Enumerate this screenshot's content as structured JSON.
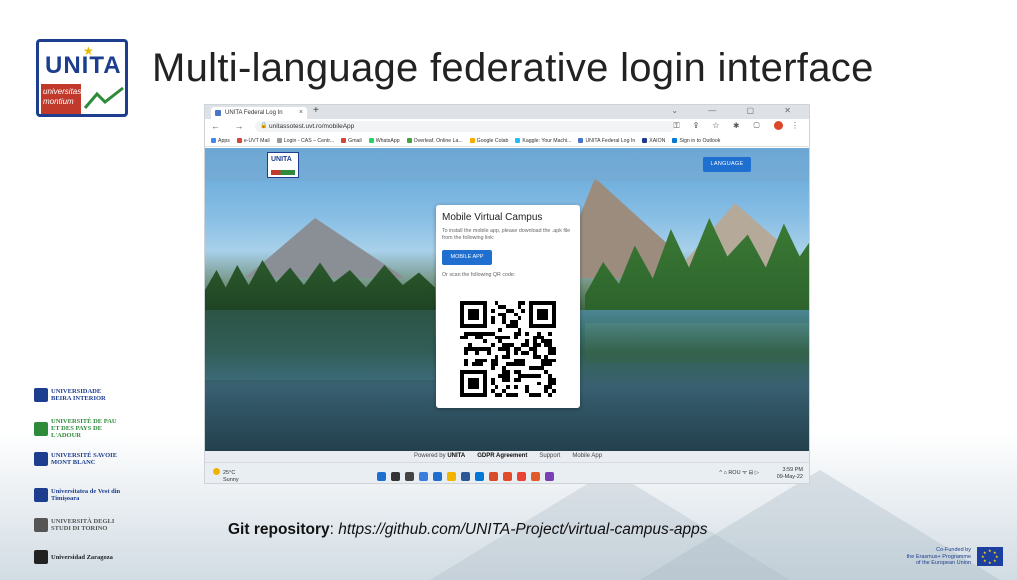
{
  "slide": {
    "title": "Multi-language federative login interface",
    "logo_text": "UNITA",
    "logo_subtitle": "universitas montium",
    "git_label": "Git repository",
    "git_sep": ": ",
    "git_url": "https://github.com/UNITA-Project/virtual-campus-apps",
    "eu_line1": "Co-Funded by",
    "eu_line2": "the Erasmus+ Programme",
    "eu_line3": "of the European Union"
  },
  "partners": [
    {
      "name": "UNIVERSIDADE BEIRA INTERIOR",
      "color": "#1d3d8f"
    },
    {
      "name": "UNIVERSITÉ DE PAU ET DES PAYS DE L'ADOUR",
      "color": "#2e8b3a"
    },
    {
      "name": "UNIVERSITÉ SAVOIE MONT BLANC",
      "color": "#1d3d8f"
    },
    {
      "name": "Universitatea de Vest din Timișoara",
      "color": "#1d3d8f"
    },
    {
      "name": "UNIVERSITÀ DEGLI STUDI DI TORINO",
      "color": "#555555"
    },
    {
      "name": "Universidad Zaragoza",
      "color": "#222222"
    }
  ],
  "browser": {
    "tab_title": "UNITA Federal Log In",
    "tab_close": "×",
    "new_tab": "+",
    "window_controls": "⌄ — ▢ ✕",
    "nav": "← → C",
    "lock": "🔒",
    "url": "unitassotest.uvt.ro/mobileApp",
    "bookmarks": [
      {
        "label": "Apps",
        "color": "#4285f4"
      },
      {
        "label": "e-UVT Mail",
        "color": "#d44638"
      },
      {
        "label": "Login - CAS – Centr...",
        "color": "#999999"
      },
      {
        "label": "Gmail",
        "color": "#d44638"
      },
      {
        "label": "WhatsApp",
        "color": "#25d366"
      },
      {
        "label": "Overleaf, Online La...",
        "color": "#47a141"
      },
      {
        "label": "Google Colab",
        "color": "#f9ab00"
      },
      {
        "label": "Kaggle: Your Machi...",
        "color": "#20beff"
      },
      {
        "label": "UNITA Federal Log In",
        "color": "#4a76c9"
      },
      {
        "label": "XAION",
        "color": "#1d3d8f"
      },
      {
        "label": "Sign in to Outlook",
        "color": "#0078d4"
      }
    ]
  },
  "page": {
    "header_logo": "UNITA",
    "language_button": "LANGUAGE",
    "card_title": "Mobile Virtual Campus",
    "card_text": "To install the mobile app, please download the .apk file from the following link:",
    "mobile_app_button": "MOBILE APP",
    "qr_text": "Or scan the following QR code:",
    "footer_powered": "Powered by ",
    "footer_unita": "UNITA",
    "footer_gdpr": "GDPR Agreement",
    "footer_support": "Support",
    "footer_mobile": "Mobile App"
  },
  "taskbar": {
    "temperature": "25°C",
    "weather": "Sunny",
    "tray_icons": "^ ⌂ ROU ᯤ ⊟ ▷",
    "time": "3:59 PM",
    "date": "09-May-22",
    "apps": [
      "#1e6fd0",
      "#333333",
      "#444444",
      "#3b7ddd",
      "#1e6fd0",
      "#f2b400",
      "#2b5797",
      "#0078d4",
      "#d94c2b",
      "#e24a2a",
      "#ea4335",
      "#e05a2a",
      "#7b3fb8"
    ]
  }
}
